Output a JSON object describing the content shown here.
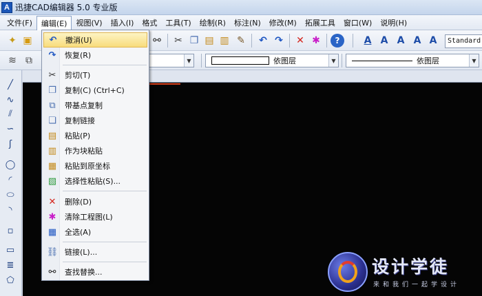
{
  "titlebar": {
    "app_icon": "A",
    "title": "迅捷CAD编辑器 5.0 专业版"
  },
  "menubar": {
    "items": [
      {
        "label": "文件(F)"
      },
      {
        "label": "编辑(E)"
      },
      {
        "label": "视图(V)"
      },
      {
        "label": "插入(I)"
      },
      {
        "label": "格式"
      },
      {
        "label": "工具(T)"
      },
      {
        "label": "绘制(R)"
      },
      {
        "label": "标注(N)"
      },
      {
        "label": "修改(M)"
      },
      {
        "label": "拓展工具"
      },
      {
        "label": "窗口(W)"
      },
      {
        "label": "说明(H)"
      }
    ]
  },
  "toolbar": {
    "text_style": "Standard"
  },
  "properties": {
    "color_layer": "依图层",
    "linetype_layer": "依图层"
  },
  "edit_menu": {
    "items": [
      {
        "label": "撤消(U)",
        "icon": "undo-icon"
      },
      {
        "label": "恢复(R)",
        "icon": "redo-icon"
      },
      {
        "label": "剪切(T)",
        "icon": "scissors-icon"
      },
      {
        "label": "复制(C) (Ctrl+C)",
        "icon": "copy-icon"
      },
      {
        "label": "带基点复制",
        "icon": "copy-base-point-icon"
      },
      {
        "label": "复制链接",
        "icon": "copy-link-icon"
      },
      {
        "label": "粘贴(P)",
        "icon": "paste-icon"
      },
      {
        "label": "作为块粘贴",
        "icon": "paste-as-block-icon"
      },
      {
        "label": "粘贴到原坐标",
        "icon": "paste-to-original-icon"
      },
      {
        "label": "选择性粘贴(S)...",
        "icon": "paste-special-icon"
      },
      {
        "label": "删除(D)",
        "icon": "delete-x-icon"
      },
      {
        "label": "清除工程图(L)",
        "icon": "purge-icon"
      },
      {
        "label": "全选(A)",
        "icon": "select-all-icon"
      },
      {
        "label": "链接(L)...",
        "icon": "link-icon"
      },
      {
        "label": "查找替换...",
        "icon": "binoculars-icon"
      }
    ]
  },
  "watermark": {
    "title": "设计学徒",
    "subtitle": "来和我们一起学设计"
  },
  "colors": {
    "canvas": "#050505",
    "highlight": "#f8dc7c",
    "accent": "#1b56b8"
  }
}
